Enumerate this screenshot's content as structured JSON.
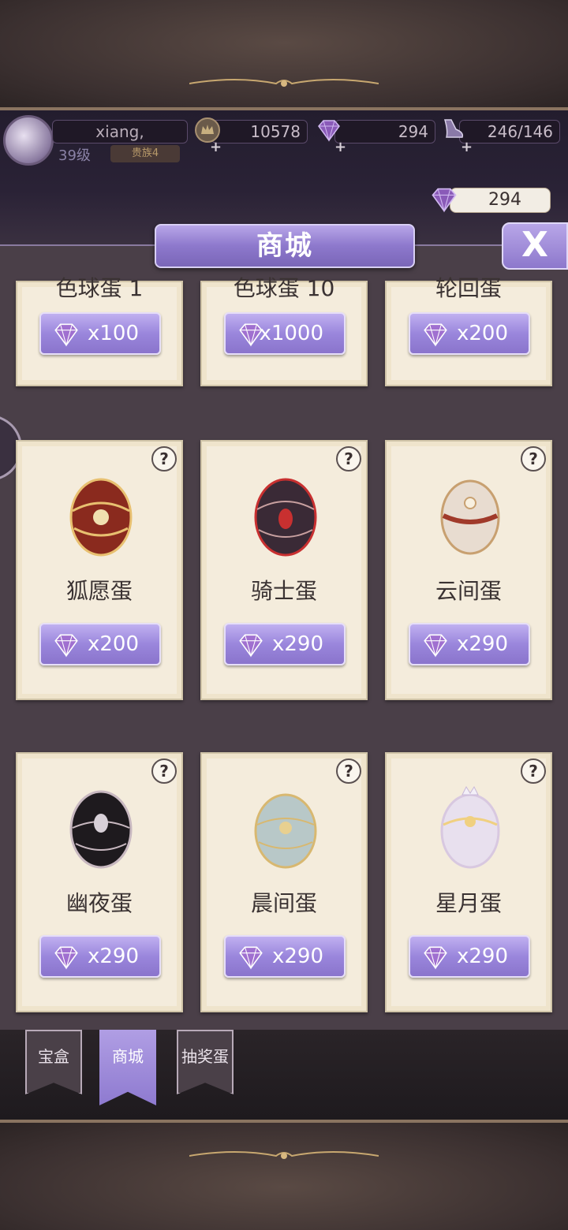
{
  "header": {
    "player_name": "xiang,",
    "level": "39级",
    "title_badge": "贵族4",
    "gold": "10578",
    "gems": "294",
    "stamina": "246/146"
  },
  "gem_balance": "294",
  "shop": {
    "title": "商城",
    "close_label": "X",
    "help_label": "?",
    "top_row": [
      {
        "name": "色球蛋 1",
        "price": "x100"
      },
      {
        "name": "色球蛋 10",
        "price": "x1000"
      },
      {
        "name": "轮回蛋",
        "price": "x200"
      }
    ],
    "items": [
      {
        "name": "狐愿蛋",
        "price": "x200",
        "egg_color": "#8a2a1e",
        "egg_accent": "#e8c070"
      },
      {
        "name": "骑士蛋",
        "price": "x290",
        "egg_color": "#3a2a36",
        "egg_accent": "#c83030"
      },
      {
        "name": "云间蛋",
        "price": "x290",
        "egg_color": "#e8dcd0",
        "egg_accent": "#a03a2a"
      },
      {
        "name": "幽夜蛋",
        "price": "x290",
        "egg_color": "#1e1a1e",
        "egg_accent": "#c8b8c0"
      },
      {
        "name": "晨间蛋",
        "price": "x290",
        "egg_color": "#b8c8c8",
        "egg_accent": "#d8b870"
      },
      {
        "name": "星月蛋",
        "price": "x290",
        "egg_color": "#e8e0ee",
        "egg_accent": "#f0d080"
      }
    ]
  },
  "tabs": [
    {
      "label": "宝盒",
      "active": false
    },
    {
      "label": "商城",
      "active": true
    },
    {
      "label": "抽奖蛋",
      "active": false
    }
  ],
  "colors": {
    "accent": "#9a86dc",
    "card_bg": "#f4ecdc",
    "panel_bg": "#4a3f48"
  }
}
